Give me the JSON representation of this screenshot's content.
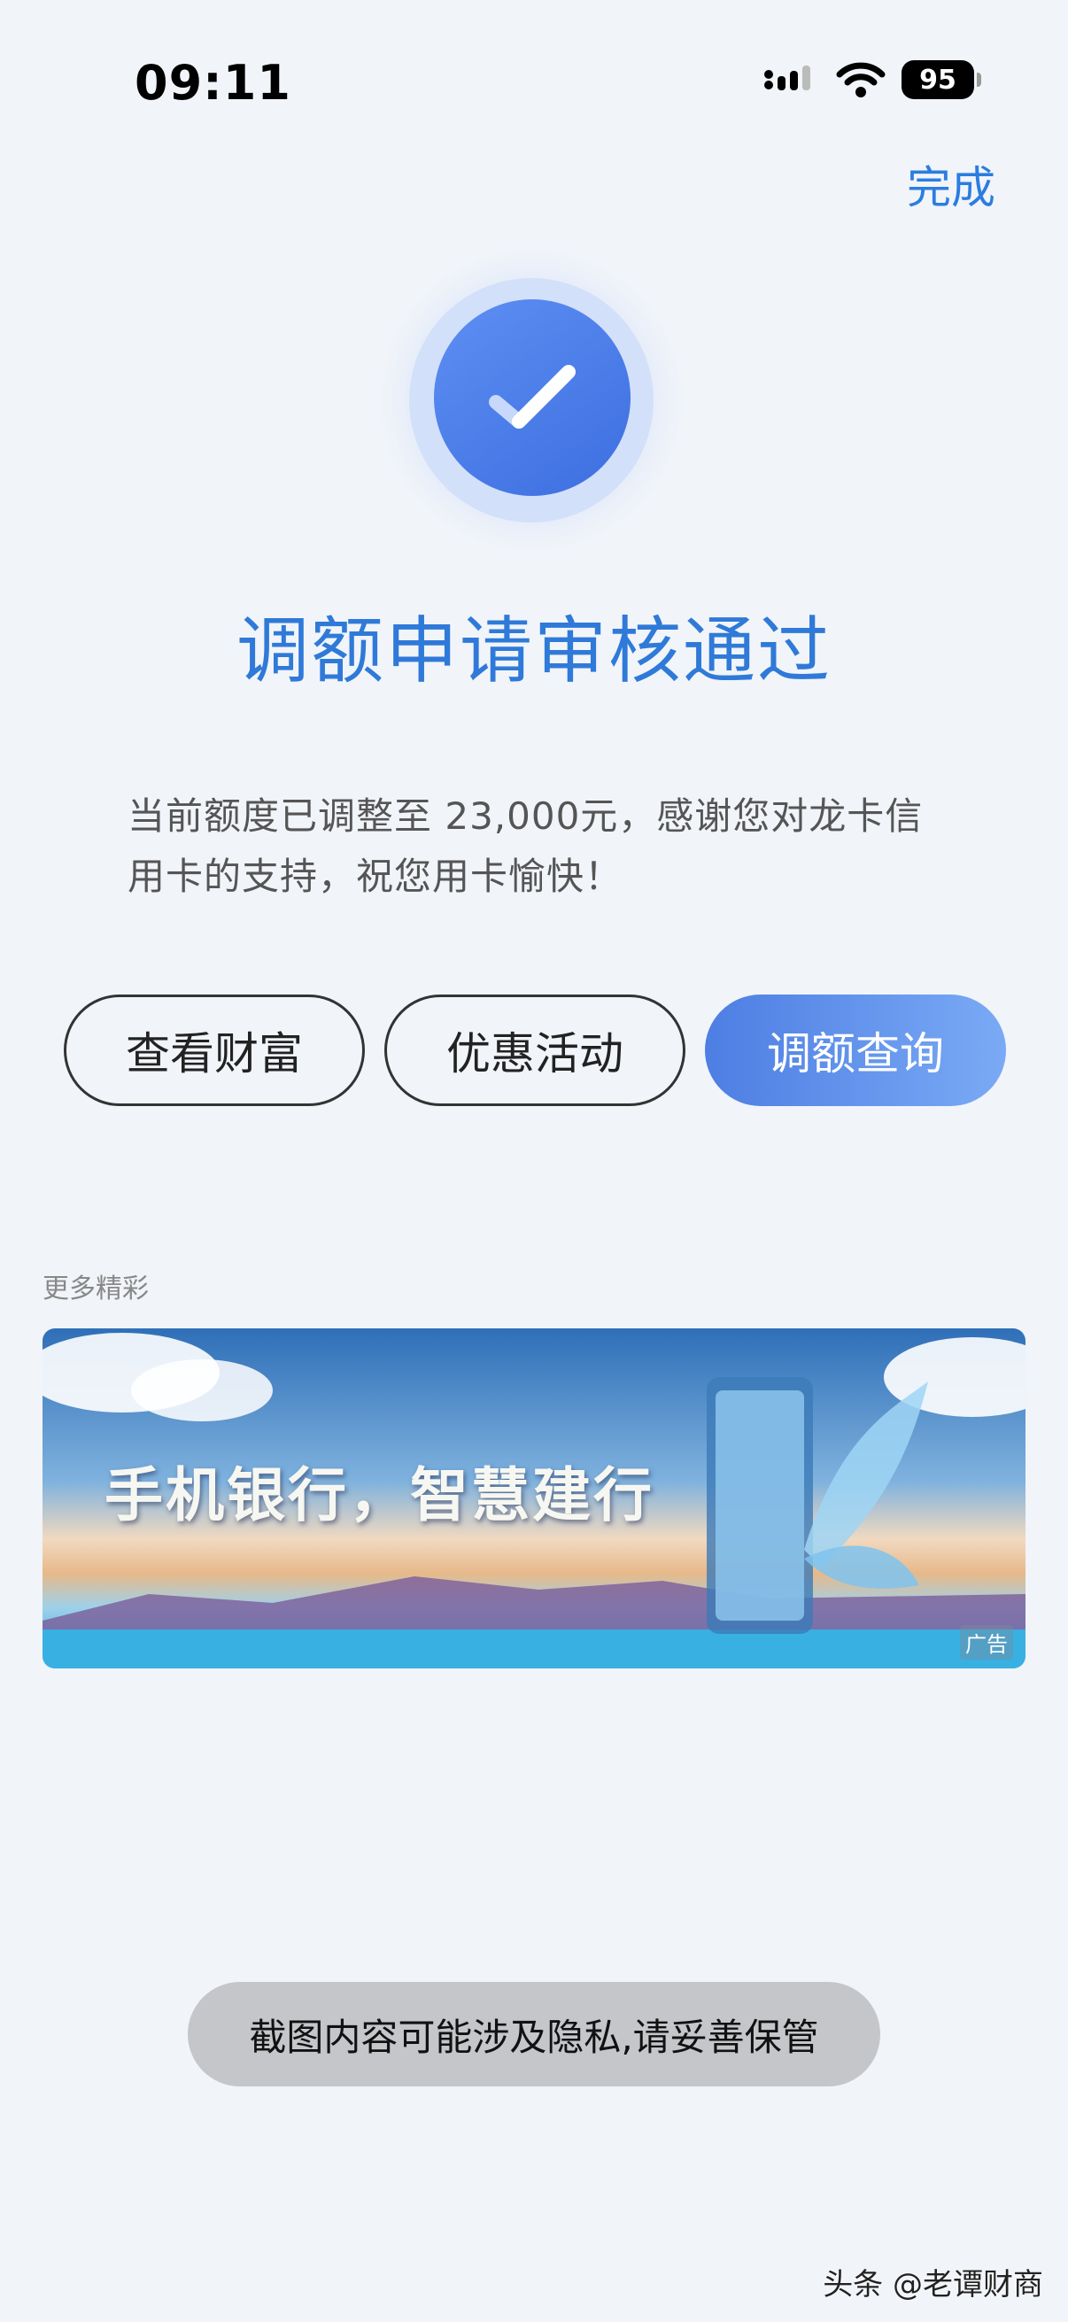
{
  "status_bar": {
    "time": "09:11",
    "battery": "95",
    "signal_icon": "cellular-signal-icon",
    "wifi_icon": "wifi-icon"
  },
  "header": {
    "done_label": "完成"
  },
  "result": {
    "icon": "check-circle-icon",
    "title": "调额申请审核通过",
    "description": "当前额度已调整至 23,000元，感谢您对龙卡信用卡的支持，祝您用卡愉快！"
  },
  "actions": [
    {
      "label": "查看财富"
    },
    {
      "label": "优惠活动"
    },
    {
      "label": "调额查询"
    }
  ],
  "more": {
    "section_label": "更多精彩",
    "banner_text": "手机银行，智慧建行",
    "ad_tag": "广告"
  },
  "toast": {
    "message": "截图内容可能涉及隐私,请妥善保管"
  },
  "watermark": "头条 @老谭财商",
  "colors": {
    "accent": "#2f7ad8",
    "background": "#f1f4f9",
    "primary_button_start": "#4d7ee3",
    "primary_button_end": "#7aaaf5"
  }
}
